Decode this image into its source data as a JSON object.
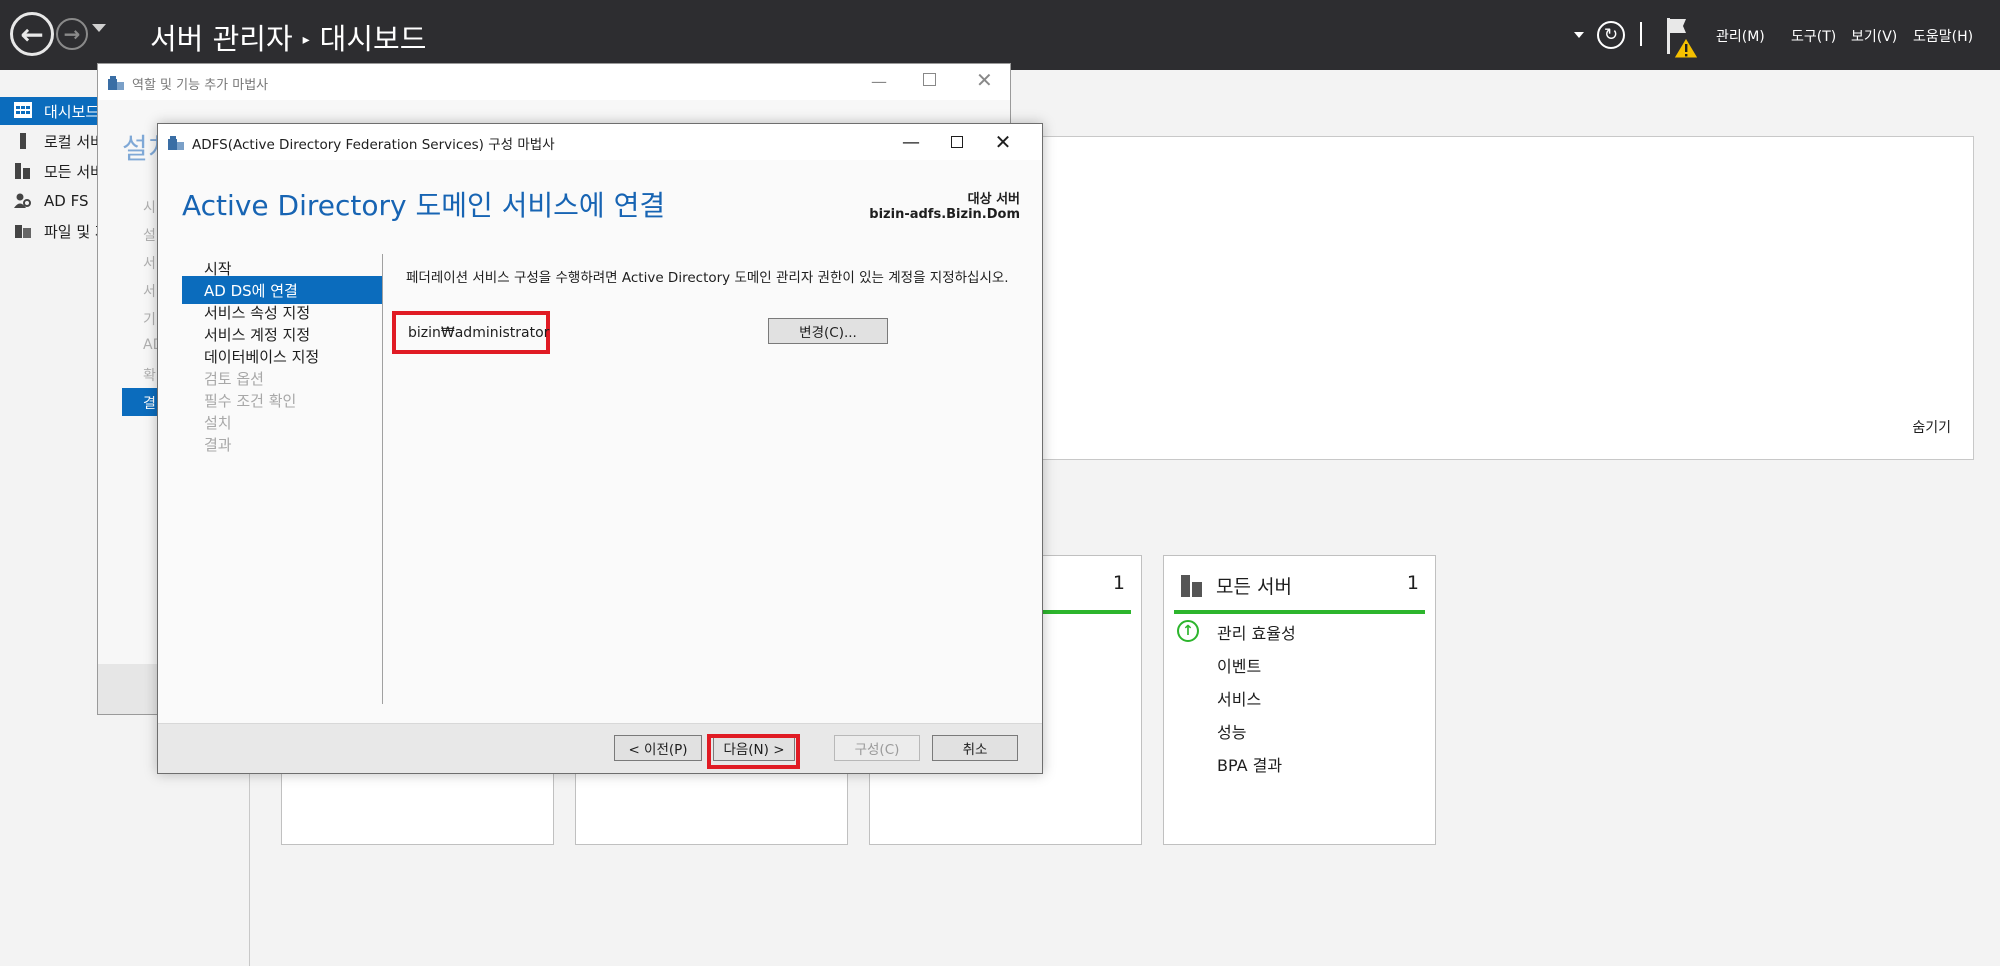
{
  "app": {
    "breadcrumb_root": "서버 관리자",
    "breadcrumb_sep": "▸",
    "breadcrumb_page": "대시보드"
  },
  "menu": {
    "manage": "관리(M)",
    "tools": "도구(T)",
    "view": "보기(V)",
    "help": "도움말(H)"
  },
  "leftnav": {
    "items": [
      {
        "label": "대시보드",
        "icon": "dashboard-icon"
      },
      {
        "label": "로컬 서버",
        "icon": "server-icon"
      },
      {
        "label": "모든 서버",
        "icon": "servers-icon"
      },
      {
        "label": "AD FS",
        "icon": "adfs-icon"
      },
      {
        "label": "파일 및 저장소 서비스",
        "icon": "folder-icon"
      }
    ]
  },
  "dashboard": {
    "hide": "숨기기",
    "tile_left_count": "1",
    "all_servers": {
      "title": "모든 서버",
      "count": "1",
      "rows": [
        "관리 효율성",
        "이벤트",
        "서비스",
        "성능",
        "BPA 결과"
      ]
    }
  },
  "bg_wizard": {
    "title": "역할 및 기능 추가 마법사",
    "heading_fragment": "설치",
    "steps": [
      "시",
      "설",
      "서",
      "서",
      "기",
      "AD",
      "확",
      "결"
    ]
  },
  "wizard": {
    "title": "ADFS(Active Directory Federation Services) 구성 마법사",
    "heading": "Active Directory 도메인 서비스에 연결",
    "target_label": "대상 서버",
    "target_server": "bizin-adfs.Bizin.Dom",
    "steps": [
      {
        "label": "시작",
        "state": "normal"
      },
      {
        "label": "AD DS에 연결",
        "state": "selected"
      },
      {
        "label": "서비스 속성 지정",
        "state": "normal"
      },
      {
        "label": "서비스 계정 지정",
        "state": "normal"
      },
      {
        "label": "데이터베이스 지정",
        "state": "normal"
      },
      {
        "label": "검토 옵션",
        "state": "disabled"
      },
      {
        "label": "필수 조건 확인",
        "state": "disabled"
      },
      {
        "label": "설치",
        "state": "disabled"
      },
      {
        "label": "결과",
        "state": "disabled"
      }
    ],
    "description": "페더레이션 서비스 구성을 수행하려면 Active Directory 도메인 관리자 권한이 있는 계정을 지정하십시오.",
    "account": "bizin₩administrator",
    "change_button": "변경(C)...",
    "prev_button": "< 이전(P)",
    "next_button": "다음(N) >",
    "configure_button": "구성(C)",
    "cancel_button": "취소"
  },
  "colors": {
    "accent": "#0b6cbd",
    "highlight": "#e01b24",
    "status_green": "#2db52d",
    "heading_blue": "#1764b3",
    "topbar": "#2d2d30"
  }
}
